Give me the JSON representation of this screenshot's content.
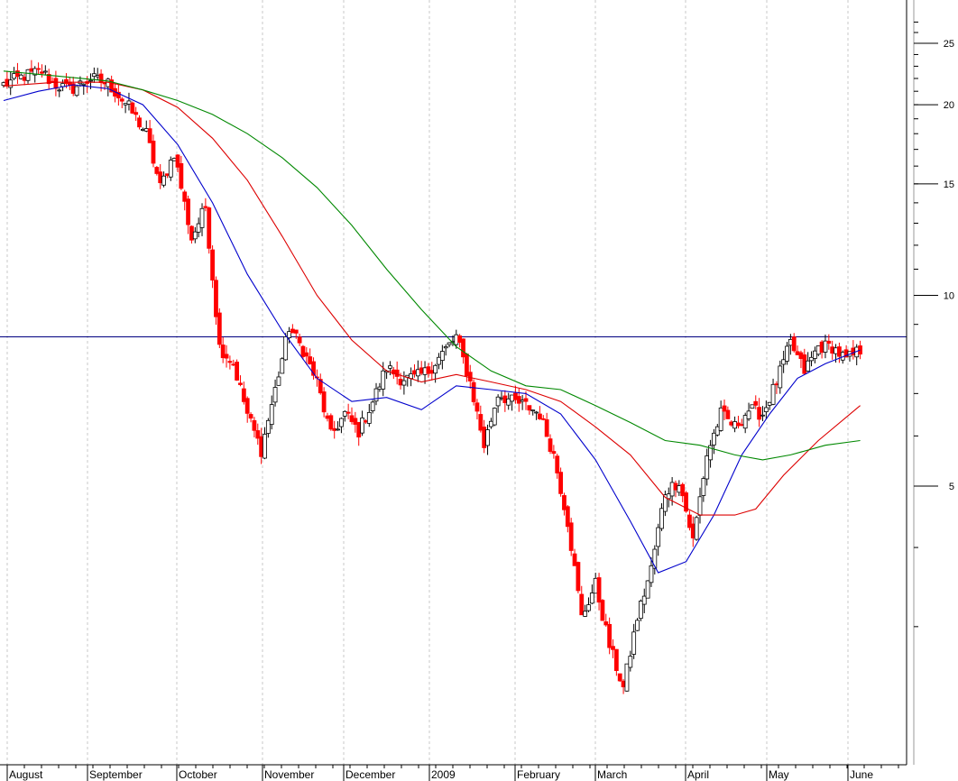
{
  "chart_data": {
    "type": "candlestick",
    "x_axis": {
      "labels": [
        "August",
        "September",
        "October",
        "November",
        "December",
        "2009",
        "February",
        "March",
        "April",
        "May",
        "June"
      ]
    },
    "y_axis": {
      "scale": "log",
      "ylim": [
        2.1,
        28
      ],
      "tick_labels": [
        "5",
        "10",
        "15",
        "20",
        "25"
      ],
      "position": "right"
    },
    "grid": {
      "vertical_dashed": true
    },
    "reference_line": {
      "value": 8.6,
      "color": "#000080"
    },
    "colors": {
      "up": "#ffffff",
      "down": "#ff0000",
      "moving_average_short": "#0000cc",
      "moving_average_mid": "#dd0000",
      "moving_average_long": "#008800",
      "axis": "#000000"
    },
    "anchors": [
      {
        "i": 0,
        "v": 21.5
      },
      {
        "i": 6,
        "v": 22.2
      },
      {
        "i": 11,
        "v": 22.6
      },
      {
        "i": 14,
        "v": 21.6
      },
      {
        "i": 19,
        "v": 21.1
      },
      {
        "i": 25,
        "v": 22.0
      },
      {
        "i": 30,
        "v": 21.6
      },
      {
        "i": 36,
        "v": 19.8
      },
      {
        "i": 41,
        "v": 18.0
      },
      {
        "i": 45,
        "v": 14.8
      },
      {
        "i": 49,
        "v": 16.8
      },
      {
        "i": 54,
        "v": 12.3
      },
      {
        "i": 58,
        "v": 13.8
      },
      {
        "i": 62,
        "v": 8.3
      },
      {
        "i": 66,
        "v": 7.8
      },
      {
        "i": 70,
        "v": 6.5
      },
      {
        "i": 74,
        "v": 5.7
      },
      {
        "i": 78,
        "v": 7.1
      },
      {
        "i": 82,
        "v": 8.9
      },
      {
        "i": 86,
        "v": 8.2
      },
      {
        "i": 90,
        "v": 7.3
      },
      {
        "i": 94,
        "v": 6.0
      },
      {
        "i": 98,
        "v": 6.5
      },
      {
        "i": 102,
        "v": 6.1
      },
      {
        "i": 106,
        "v": 6.8
      },
      {
        "i": 110,
        "v": 7.7
      },
      {
        "i": 114,
        "v": 7.4
      },
      {
        "i": 118,
        "v": 7.4
      },
      {
        "i": 122,
        "v": 7.6
      },
      {
        "i": 126,
        "v": 8.1
      },
      {
        "i": 130,
        "v": 8.6
      },
      {
        "i": 134,
        "v": 7.3
      },
      {
        "i": 138,
        "v": 5.8
      },
      {
        "i": 142,
        "v": 7.0
      },
      {
        "i": 146,
        "v": 6.8
      },
      {
        "i": 150,
        "v": 6.7
      },
      {
        "i": 154,
        "v": 6.5
      },
      {
        "i": 158,
        "v": 5.6
      },
      {
        "i": 162,
        "v": 4.4
      },
      {
        "i": 166,
        "v": 3.1
      },
      {
        "i": 170,
        "v": 3.5
      },
      {
        "i": 174,
        "v": 2.8
      },
      {
        "i": 178,
        "v": 2.4
      },
      {
        "i": 182,
        "v": 3.1
      },
      {
        "i": 186,
        "v": 3.7
      },
      {
        "i": 190,
        "v": 4.9
      },
      {
        "i": 194,
        "v": 5.1
      },
      {
        "i": 198,
        "v": 4.1
      },
      {
        "i": 202,
        "v": 5.6
      },
      {
        "i": 206,
        "v": 6.5
      },
      {
        "i": 210,
        "v": 6.2
      },
      {
        "i": 214,
        "v": 6.6
      },
      {
        "i": 218,
        "v": 6.5
      },
      {
        "i": 222,
        "v": 7.3
      },
      {
        "i": 226,
        "v": 8.4
      },
      {
        "i": 230,
        "v": 7.6
      },
      {
        "i": 234,
        "v": 8.3
      },
      {
        "i": 238,
        "v": 8.3
      },
      {
        "i": 242,
        "v": 7.9
      },
      {
        "i": 246,
        "v": 8.2
      }
    ],
    "moving_averages": [
      {
        "key": "short",
        "color": "#0000cc",
        "points": [
          [
            0,
            20.3
          ],
          [
            10,
            21.0
          ],
          [
            20,
            21.5
          ],
          [
            30,
            21.2
          ],
          [
            40,
            20.0
          ],
          [
            50,
            17.3
          ],
          [
            60,
            14.0
          ],
          [
            70,
            10.8
          ],
          [
            80,
            8.8
          ],
          [
            90,
            7.4
          ],
          [
            100,
            6.8
          ],
          [
            110,
            6.9
          ],
          [
            120,
            6.6
          ],
          [
            130,
            7.2
          ],
          [
            140,
            7.1
          ],
          [
            150,
            7.0
          ],
          [
            160,
            6.5
          ],
          [
            170,
            5.5
          ],
          [
            180,
            4.4
          ],
          [
            188,
            3.65
          ],
          [
            196,
            3.8
          ],
          [
            204,
            4.5
          ],
          [
            212,
            5.6
          ],
          [
            220,
            6.5
          ],
          [
            228,
            7.4
          ],
          [
            236,
            7.8
          ],
          [
            246,
            8.2
          ]
        ]
      },
      {
        "key": "mid",
        "color": "#dd0000",
        "points": [
          [
            0,
            21.4
          ],
          [
            15,
            21.7
          ],
          [
            30,
            21.7
          ],
          [
            40,
            21.1
          ],
          [
            50,
            19.8
          ],
          [
            60,
            17.7
          ],
          [
            70,
            15.2
          ],
          [
            80,
            12.4
          ],
          [
            90,
            10.0
          ],
          [
            100,
            8.5
          ],
          [
            110,
            7.6
          ],
          [
            120,
            7.3
          ],
          [
            130,
            7.5
          ],
          [
            140,
            7.3
          ],
          [
            150,
            7.1
          ],
          [
            160,
            6.8
          ],
          [
            170,
            6.2
          ],
          [
            180,
            5.6
          ],
          [
            190,
            4.8
          ],
          [
            200,
            4.5
          ],
          [
            210,
            4.5
          ],
          [
            216,
            4.6
          ],
          [
            224,
            5.2
          ],
          [
            234,
            5.9
          ],
          [
            246,
            6.7
          ]
        ]
      },
      {
        "key": "long",
        "color": "#008800",
        "points": [
          [
            0,
            22.6
          ],
          [
            15,
            22.2
          ],
          [
            30,
            21.8
          ],
          [
            40,
            21.1
          ],
          [
            50,
            20.3
          ],
          [
            60,
            19.3
          ],
          [
            70,
            18.0
          ],
          [
            80,
            16.5
          ],
          [
            90,
            14.8
          ],
          [
            100,
            12.9
          ],
          [
            110,
            11.0
          ],
          [
            120,
            9.5
          ],
          [
            130,
            8.3
          ],
          [
            140,
            7.6
          ],
          [
            150,
            7.2
          ],
          [
            160,
            7.1
          ],
          [
            170,
            6.7
          ],
          [
            180,
            6.3
          ],
          [
            190,
            5.9
          ],
          [
            200,
            5.8
          ],
          [
            210,
            5.6
          ],
          [
            218,
            5.5
          ],
          [
            226,
            5.6
          ],
          [
            236,
            5.8
          ],
          [
            246,
            5.9
          ]
        ]
      }
    ]
  }
}
